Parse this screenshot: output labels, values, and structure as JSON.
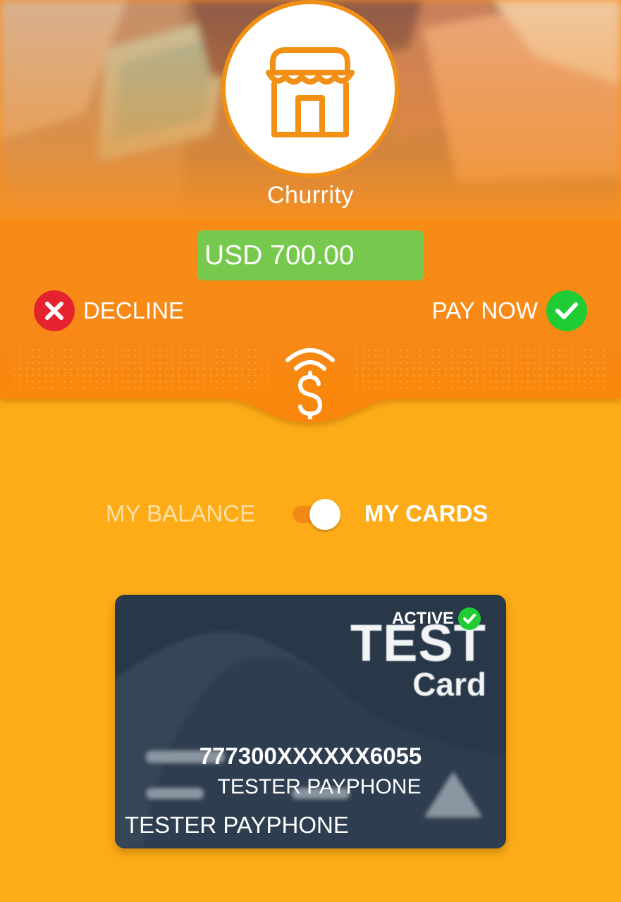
{
  "merchant": {
    "name": "Churrity",
    "logo_icon": "store-icon"
  },
  "payment": {
    "amount": "USD 700.00"
  },
  "actions": {
    "decline_label": "DECLINE",
    "pay_now_label": "PAY NOW",
    "decline_icon": "close-icon",
    "pay_now_icon": "check-icon"
  },
  "source_toggle": {
    "left_label": "MY BALANCE",
    "right_label": "MY CARDS",
    "selected": "MY CARDS"
  },
  "card": {
    "status": "ACTIVE",
    "brand_line1": "TEST",
    "brand_line2": "Card",
    "number": "777300XXXXXX6055",
    "holder_name": "TESTER PAYPHONE",
    "holder_name_bottom": "TESTER PAYPHONE"
  },
  "colors": {
    "background": "#fdac17",
    "panel_orange": "#f8901a",
    "amount_green": "#77c94e",
    "decline_red": "#e5232f",
    "accept_green": "#1fcc33",
    "card_dark": "#283849"
  }
}
